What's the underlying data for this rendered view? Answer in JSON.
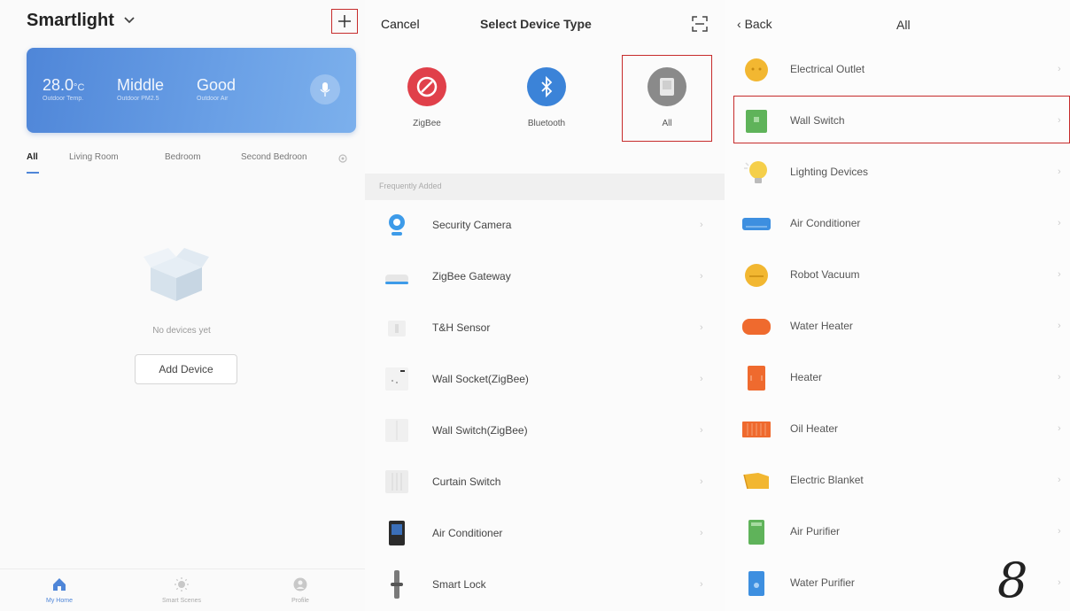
{
  "panel_home": {
    "home_name": "Smartlight",
    "weather": [
      {
        "value": "28.0",
        "unit": "°C",
        "label": "Outdoor Temp."
      },
      {
        "value": "Middle",
        "unit": "",
        "label": "Outdoor PM2.5"
      },
      {
        "value": "Good",
        "unit": "",
        "label": "Outdoor Air"
      }
    ],
    "rooms": [
      "All",
      "Living Room",
      "Bedroom",
      "Second Bedroon"
    ],
    "empty_text": "No devices yet",
    "add_device_label": "Add Device",
    "nav": [
      {
        "label": "My Home",
        "icon": "home-icon"
      },
      {
        "label": "Smart Scenes",
        "icon": "sun-icon"
      },
      {
        "label": "Profile",
        "icon": "profile-icon"
      }
    ]
  },
  "panel_select": {
    "cancel_label": "Cancel",
    "title": "Select Device Type",
    "types": [
      {
        "label": "ZigBee",
        "color": "#e0404a",
        "icon": "zigbee-icon"
      },
      {
        "label": "Bluetooth",
        "color": "#3b83d8",
        "icon": "bluetooth-icon"
      },
      {
        "label": "All",
        "color": "#8a8a8a",
        "icon": "all-devices-icon"
      }
    ],
    "frequently_added_label": "Frequently Added",
    "devices": [
      {
        "label": "Security Camera",
        "icon": "security-camera-icon"
      },
      {
        "label": "ZigBee Gateway",
        "icon": "gateway-icon"
      },
      {
        "label": "T&H Sensor",
        "icon": "sensor-icon"
      },
      {
        "label": "Wall Socket(ZigBee)",
        "icon": "wall-socket-icon"
      },
      {
        "label": "Wall Switch(ZigBee)",
        "icon": "wall-switch-icon"
      },
      {
        "label": "Curtain Switch",
        "icon": "curtain-switch-icon"
      },
      {
        "label": "Air Conditioner",
        "icon": "air-conditioner-remote-icon"
      },
      {
        "label": "Smart Lock",
        "icon": "smart-lock-icon"
      }
    ]
  },
  "panel_all": {
    "back_label": "Back",
    "title": "All",
    "categories": [
      {
        "label": "Electrical Outlet",
        "icon": "outlet-icon",
        "color": "#f2b731"
      },
      {
        "label": "Wall Switch",
        "icon": "wall-switch-icon",
        "color": "#5fb35a"
      },
      {
        "label": "Lighting Devices",
        "icon": "bulb-icon",
        "color": "#f5cf4a"
      },
      {
        "label": "Air Conditioner",
        "icon": "air-conditioner-icon",
        "color": "#3d8fe0"
      },
      {
        "label": "Robot Vacuum",
        "icon": "robot-vacuum-icon",
        "color": "#f2b731"
      },
      {
        "label": "Water Heater",
        "icon": "water-heater-icon",
        "color": "#ef6a2e"
      },
      {
        "label": "Heater",
        "icon": "heater-icon",
        "color": "#ef6a2e"
      },
      {
        "label": "Oil Heater",
        "icon": "oil-heater-icon",
        "color": "#ef6a2e"
      },
      {
        "label": "Electric Blanket",
        "icon": "blanket-icon",
        "color": "#f2b731"
      },
      {
        "label": "Air Purifier",
        "icon": "air-purifier-icon",
        "color": "#5fb35a"
      },
      {
        "label": "Water Purifier",
        "icon": "water-purifier-icon",
        "color": "#3d8fe0"
      }
    ],
    "page_number": "8"
  }
}
